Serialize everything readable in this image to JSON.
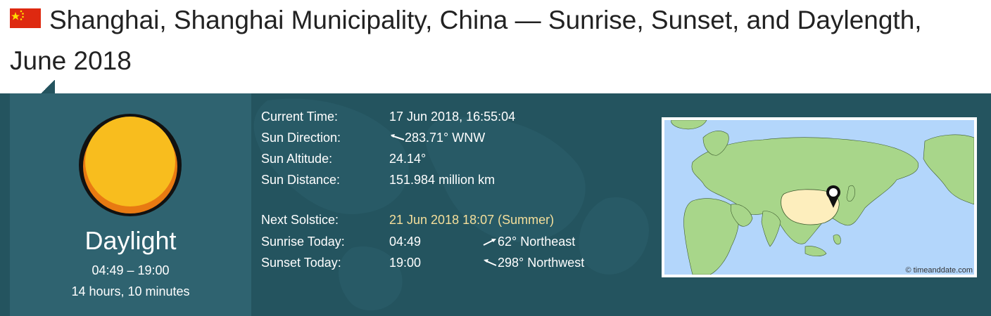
{
  "page": {
    "title": "Shanghai, Shanghai Municipality, China — Sunrise, Sunset, and Daylength, June 2018",
    "flag_icon": "china-flag-icon"
  },
  "state": {
    "label": "Daylight",
    "range": "04:49 – 19:00",
    "length": "14 hours, 10 minutes",
    "sun_icon": "sun-icon",
    "sun_color": "#f8bd1e"
  },
  "info": {
    "current_time": {
      "label": "Current Time:",
      "value": "17 Jun 2018, 16:55:04"
    },
    "sun_direction": {
      "label": "Sun Direction:",
      "value": "283.71° WNW"
    },
    "sun_altitude": {
      "label": "Sun Altitude:",
      "value": "24.14°"
    },
    "sun_distance": {
      "label": "Sun Distance:",
      "value": "151.984 million km"
    },
    "next_solstice": {
      "label": "Next Solstice:",
      "value": "21 Jun 2018 18:07 (Summer)"
    },
    "sunrise_today": {
      "label": "Sunrise Today:",
      "time": "04:49",
      "direction": "62° Northeast"
    },
    "sunset_today": {
      "label": "Sunset Today:",
      "time": "19:00",
      "direction": "298° Northwest"
    }
  },
  "map": {
    "credit": "© timeanddate.com",
    "ocean_color": "#b3d6fb",
    "land_color": "#a8d68a",
    "highlight_color": "#fdeebd",
    "marker_icon": "location-pin-icon"
  },
  "colors": {
    "panel": "#24545f",
    "left_box": "#2f6370",
    "solstice_text": "#f5df9b"
  }
}
